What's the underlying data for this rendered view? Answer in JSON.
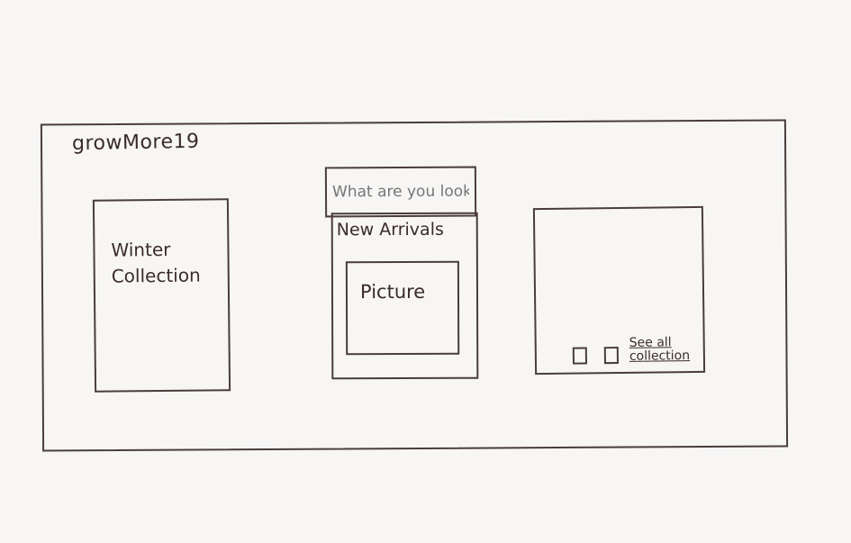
{
  "header": {
    "brand": "growMore19"
  },
  "search": {
    "placeholder": "What are you looking for?"
  },
  "cards": {
    "winter": {
      "label": "Winter Collection"
    },
    "arrivals": {
      "title": "New Arrivals",
      "picture_label": "Picture"
    },
    "collection": {
      "see_all_label": "See all collection"
    }
  }
}
